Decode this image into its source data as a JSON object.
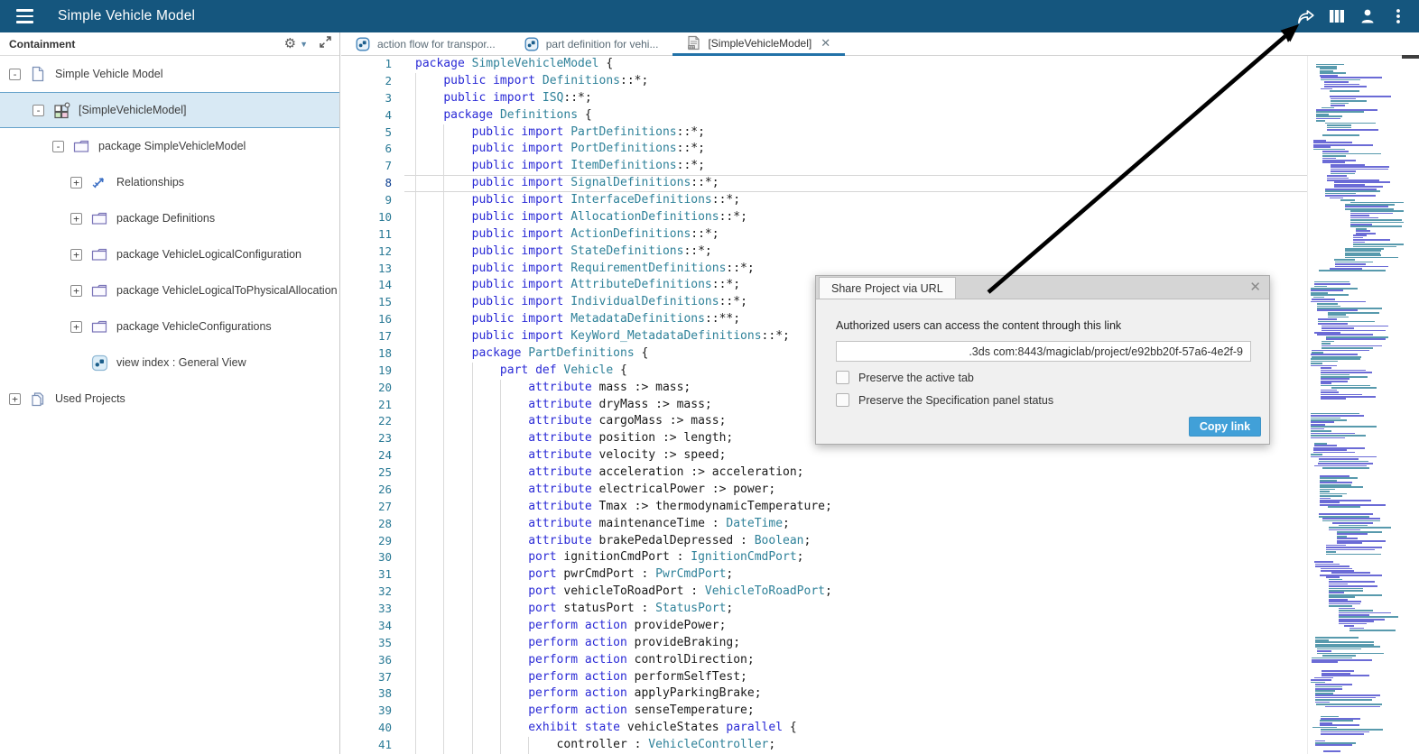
{
  "header": {
    "title": "Simple Vehicle Model",
    "icons": [
      "menu",
      "share",
      "apps-grid",
      "user",
      "more-menu"
    ]
  },
  "panel": {
    "title": "Containment",
    "tree": [
      {
        "label": "Simple Vehicle Model",
        "icon": "document",
        "toggle": "-",
        "level": 0,
        "selected": false
      },
      {
        "label": "[SimpleVehicleModel]",
        "icon": "model-grid",
        "toggle": "-",
        "level": 1,
        "selected": true
      },
      {
        "label": "package SimpleVehicleModel",
        "icon": "folder",
        "toggle": "-",
        "level": 2,
        "selected": false
      },
      {
        "label": "Relationships",
        "icon": "relationship",
        "toggle": "+",
        "level": 3,
        "selected": false
      },
      {
        "label": "package Definitions",
        "icon": "folder",
        "toggle": "+",
        "level": 3,
        "selected": false
      },
      {
        "label": "package VehicleLogicalConfiguration",
        "icon": "folder",
        "toggle": "+",
        "level": 3,
        "selected": false
      },
      {
        "label": "package VehicleLogicalToPhysicalAllocation",
        "icon": "folder",
        "toggle": "+",
        "level": 3,
        "selected": false
      },
      {
        "label": "package VehicleConfigurations",
        "icon": "folder",
        "toggle": "+",
        "level": 3,
        "selected": false
      },
      {
        "label": "view index : General View",
        "icon": "view",
        "toggle": null,
        "level": 3,
        "selected": false
      },
      {
        "label": "Used Projects",
        "icon": "documents",
        "toggle": "+",
        "level": 0,
        "selected": false
      }
    ]
  },
  "tabs": [
    {
      "label": "action flow for transpor...",
      "icon": "diagram",
      "active": false,
      "closable": false
    },
    {
      "label": "part definition for vehi...",
      "icon": "diagram",
      "active": false,
      "closable": false
    },
    {
      "label": "[SimpleVehicleModel]",
      "icon": "text-doc",
      "active": true,
      "closable": true
    }
  ],
  "editor": {
    "active_line": 8,
    "lines": [
      [
        [
          "kw",
          "package "
        ],
        [
          "ty",
          "SimpleVehicleModel "
        ],
        [
          "pl",
          "{"
        ]
      ],
      [
        [
          "pl",
          "    "
        ],
        [
          "kw",
          "public "
        ],
        [
          "kw",
          "import "
        ],
        [
          "ty",
          "Definitions"
        ],
        [
          "pl",
          "::*;"
        ]
      ],
      [
        [
          "pl",
          "    "
        ],
        [
          "kw",
          "public "
        ],
        [
          "kw",
          "import "
        ],
        [
          "ty",
          "ISQ"
        ],
        [
          "pl",
          "::*;"
        ]
      ],
      [
        [
          "pl",
          "    "
        ],
        [
          "kw",
          "package "
        ],
        [
          "ty",
          "Definitions "
        ],
        [
          "pl",
          "{"
        ]
      ],
      [
        [
          "pl",
          "        "
        ],
        [
          "kw",
          "public "
        ],
        [
          "kw",
          "import "
        ],
        [
          "ty",
          "PartDefinitions"
        ],
        [
          "pl",
          "::*;"
        ]
      ],
      [
        [
          "pl",
          "        "
        ],
        [
          "kw",
          "public "
        ],
        [
          "kw",
          "import "
        ],
        [
          "ty",
          "PortDefinitions"
        ],
        [
          "pl",
          "::*;"
        ]
      ],
      [
        [
          "pl",
          "        "
        ],
        [
          "kw",
          "public "
        ],
        [
          "kw",
          "import "
        ],
        [
          "ty",
          "ItemDefinitions"
        ],
        [
          "pl",
          "::*;"
        ]
      ],
      [
        [
          "pl",
          "        "
        ],
        [
          "kw",
          "public "
        ],
        [
          "kw",
          "import "
        ],
        [
          "ty",
          "SignalDefinitions"
        ],
        [
          "pl",
          "::*;"
        ]
      ],
      [
        [
          "pl",
          "        "
        ],
        [
          "kw",
          "public "
        ],
        [
          "kw",
          "import "
        ],
        [
          "ty",
          "InterfaceDefinitions"
        ],
        [
          "pl",
          "::*;"
        ]
      ],
      [
        [
          "pl",
          "        "
        ],
        [
          "kw",
          "public "
        ],
        [
          "kw",
          "import "
        ],
        [
          "ty",
          "AllocationDefinitions"
        ],
        [
          "pl",
          "::*;"
        ]
      ],
      [
        [
          "pl",
          "        "
        ],
        [
          "kw",
          "public "
        ],
        [
          "kw",
          "import "
        ],
        [
          "ty",
          "ActionDefinitions"
        ],
        [
          "pl",
          "::*;"
        ]
      ],
      [
        [
          "pl",
          "        "
        ],
        [
          "kw",
          "public "
        ],
        [
          "kw",
          "import "
        ],
        [
          "ty",
          "StateDefinitions"
        ],
        [
          "pl",
          "::*;"
        ]
      ],
      [
        [
          "pl",
          "        "
        ],
        [
          "kw",
          "public "
        ],
        [
          "kw",
          "import "
        ],
        [
          "ty",
          "RequirementDefinitions"
        ],
        [
          "pl",
          "::*;"
        ]
      ],
      [
        [
          "pl",
          "        "
        ],
        [
          "kw",
          "public "
        ],
        [
          "kw",
          "import "
        ],
        [
          "ty",
          "AttributeDefinitions"
        ],
        [
          "pl",
          "::*;"
        ]
      ],
      [
        [
          "pl",
          "        "
        ],
        [
          "kw",
          "public "
        ],
        [
          "kw",
          "import "
        ],
        [
          "ty",
          "IndividualDefinitions"
        ],
        [
          "pl",
          "::*;"
        ]
      ],
      [
        [
          "pl",
          "        "
        ],
        [
          "kw",
          "public "
        ],
        [
          "kw",
          "import "
        ],
        [
          "ty",
          "MetadataDefinitions"
        ],
        [
          "pl",
          "::**;"
        ]
      ],
      [
        [
          "pl",
          "        "
        ],
        [
          "kw",
          "public "
        ],
        [
          "kw",
          "import "
        ],
        [
          "ty",
          "KeyWord_MetadataDefinitions"
        ],
        [
          "pl",
          "::*;"
        ]
      ],
      [
        [
          "pl",
          "        "
        ],
        [
          "kw",
          "package "
        ],
        [
          "ty",
          "PartDefinitions "
        ],
        [
          "pl",
          "{"
        ]
      ],
      [
        [
          "pl",
          "            "
        ],
        [
          "kw",
          "part "
        ],
        [
          "kw",
          "def "
        ],
        [
          "ty",
          "Vehicle "
        ],
        [
          "pl",
          "{"
        ]
      ],
      [
        [
          "pl",
          "                "
        ],
        [
          "kw",
          "attribute "
        ],
        [
          "pl",
          "mass :> mass;"
        ]
      ],
      [
        [
          "pl",
          "                "
        ],
        [
          "kw",
          "attribute "
        ],
        [
          "pl",
          "dryMass :> mass;"
        ]
      ],
      [
        [
          "pl",
          "                "
        ],
        [
          "kw",
          "attribute "
        ],
        [
          "pl",
          "cargoMass :> mass;"
        ]
      ],
      [
        [
          "pl",
          "                "
        ],
        [
          "kw",
          "attribute "
        ],
        [
          "pl",
          "position :> length;"
        ]
      ],
      [
        [
          "pl",
          "                "
        ],
        [
          "kw",
          "attribute "
        ],
        [
          "pl",
          "velocity :> speed;"
        ]
      ],
      [
        [
          "pl",
          "                "
        ],
        [
          "kw",
          "attribute "
        ],
        [
          "pl",
          "acceleration :> acceleration;"
        ]
      ],
      [
        [
          "pl",
          "                "
        ],
        [
          "kw",
          "attribute "
        ],
        [
          "pl",
          "electricalPower :> power;"
        ]
      ],
      [
        [
          "pl",
          "                "
        ],
        [
          "kw",
          "attribute "
        ],
        [
          "pl",
          "Tmax :> thermodynamicTemperature;"
        ]
      ],
      [
        [
          "pl",
          "                "
        ],
        [
          "kw",
          "attribute "
        ],
        [
          "pl",
          "maintenanceTime : "
        ],
        [
          "ty",
          "DateTime"
        ],
        [
          "pl",
          ";"
        ]
      ],
      [
        [
          "pl",
          "                "
        ],
        [
          "kw",
          "attribute "
        ],
        [
          "pl",
          "brakePedalDepressed : "
        ],
        [
          "ty",
          "Boolean"
        ],
        [
          "pl",
          ";"
        ]
      ],
      [
        [
          "pl",
          "                "
        ],
        [
          "kw",
          "port "
        ],
        [
          "pl",
          "ignitionCmdPort : "
        ],
        [
          "ty",
          "IgnitionCmdPort"
        ],
        [
          "pl",
          ";"
        ]
      ],
      [
        [
          "pl",
          "                "
        ],
        [
          "kw",
          "port "
        ],
        [
          "pl",
          "pwrCmdPort : "
        ],
        [
          "ty",
          "PwrCmdPort"
        ],
        [
          "pl",
          ";"
        ]
      ],
      [
        [
          "pl",
          "                "
        ],
        [
          "kw",
          "port "
        ],
        [
          "pl",
          "vehicleToRoadPort : "
        ],
        [
          "ty",
          "VehicleToRoadPort"
        ],
        [
          "pl",
          ";"
        ]
      ],
      [
        [
          "pl",
          "                "
        ],
        [
          "kw",
          "port "
        ],
        [
          "pl",
          "statusPort : "
        ],
        [
          "ty",
          "StatusPort"
        ],
        [
          "pl",
          ";"
        ]
      ],
      [
        [
          "pl",
          "                "
        ],
        [
          "kw",
          "perform "
        ],
        [
          "kw",
          "action "
        ],
        [
          "pl",
          "providePower;"
        ]
      ],
      [
        [
          "pl",
          "                "
        ],
        [
          "kw",
          "perform "
        ],
        [
          "kw",
          "action "
        ],
        [
          "pl",
          "provideBraking;"
        ]
      ],
      [
        [
          "pl",
          "                "
        ],
        [
          "kw",
          "perform "
        ],
        [
          "kw",
          "action "
        ],
        [
          "pl",
          "controlDirection;"
        ]
      ],
      [
        [
          "pl",
          "                "
        ],
        [
          "kw",
          "perform "
        ],
        [
          "kw",
          "action "
        ],
        [
          "pl",
          "performSelfTest;"
        ]
      ],
      [
        [
          "pl",
          "                "
        ],
        [
          "kw",
          "perform "
        ],
        [
          "kw",
          "action "
        ],
        [
          "pl",
          "applyParkingBrake;"
        ]
      ],
      [
        [
          "pl",
          "                "
        ],
        [
          "kw",
          "perform "
        ],
        [
          "kw",
          "action "
        ],
        [
          "pl",
          "senseTemperature;"
        ]
      ],
      [
        [
          "pl",
          "                "
        ],
        [
          "kw",
          "exhibit "
        ],
        [
          "kw",
          "state "
        ],
        [
          "pl",
          "vehicleStates "
        ],
        [
          "kw",
          "parallel "
        ],
        [
          "pl",
          "{"
        ]
      ],
      [
        [
          "pl",
          "                    "
        ],
        [
          "pl",
          "controller : "
        ],
        [
          "ty",
          "VehicleController"
        ],
        [
          "pl",
          ";"
        ]
      ]
    ]
  },
  "dialog": {
    "title": "Share Project via URL",
    "close_glyph": "✕",
    "description": "Authorized users can access the content through this link",
    "url_value": ".3ds com:8443/magiclab/project/e92bb20f-57a6-4e2f-9",
    "checkboxes": [
      {
        "label": "Preserve the active tab",
        "checked": false
      },
      {
        "label": "Preserve the Specification panel status",
        "checked": false
      }
    ],
    "copy_button": "Copy link"
  },
  "annotation": {
    "arrow_points_to": "share-button"
  },
  "minimap": {
    "color_blue": "#4646cc",
    "color_teal": "#2e8199"
  },
  "colors": {
    "header_bg": "#15567E",
    "active_tab_underline": "#2272a8",
    "selected_row_bg": "#d8e9f4",
    "keyword": "#2a2ad6",
    "type_ref": "#2e8199",
    "line_number": "#2a7a96",
    "copy_button_bg": "#41a0d8"
  }
}
